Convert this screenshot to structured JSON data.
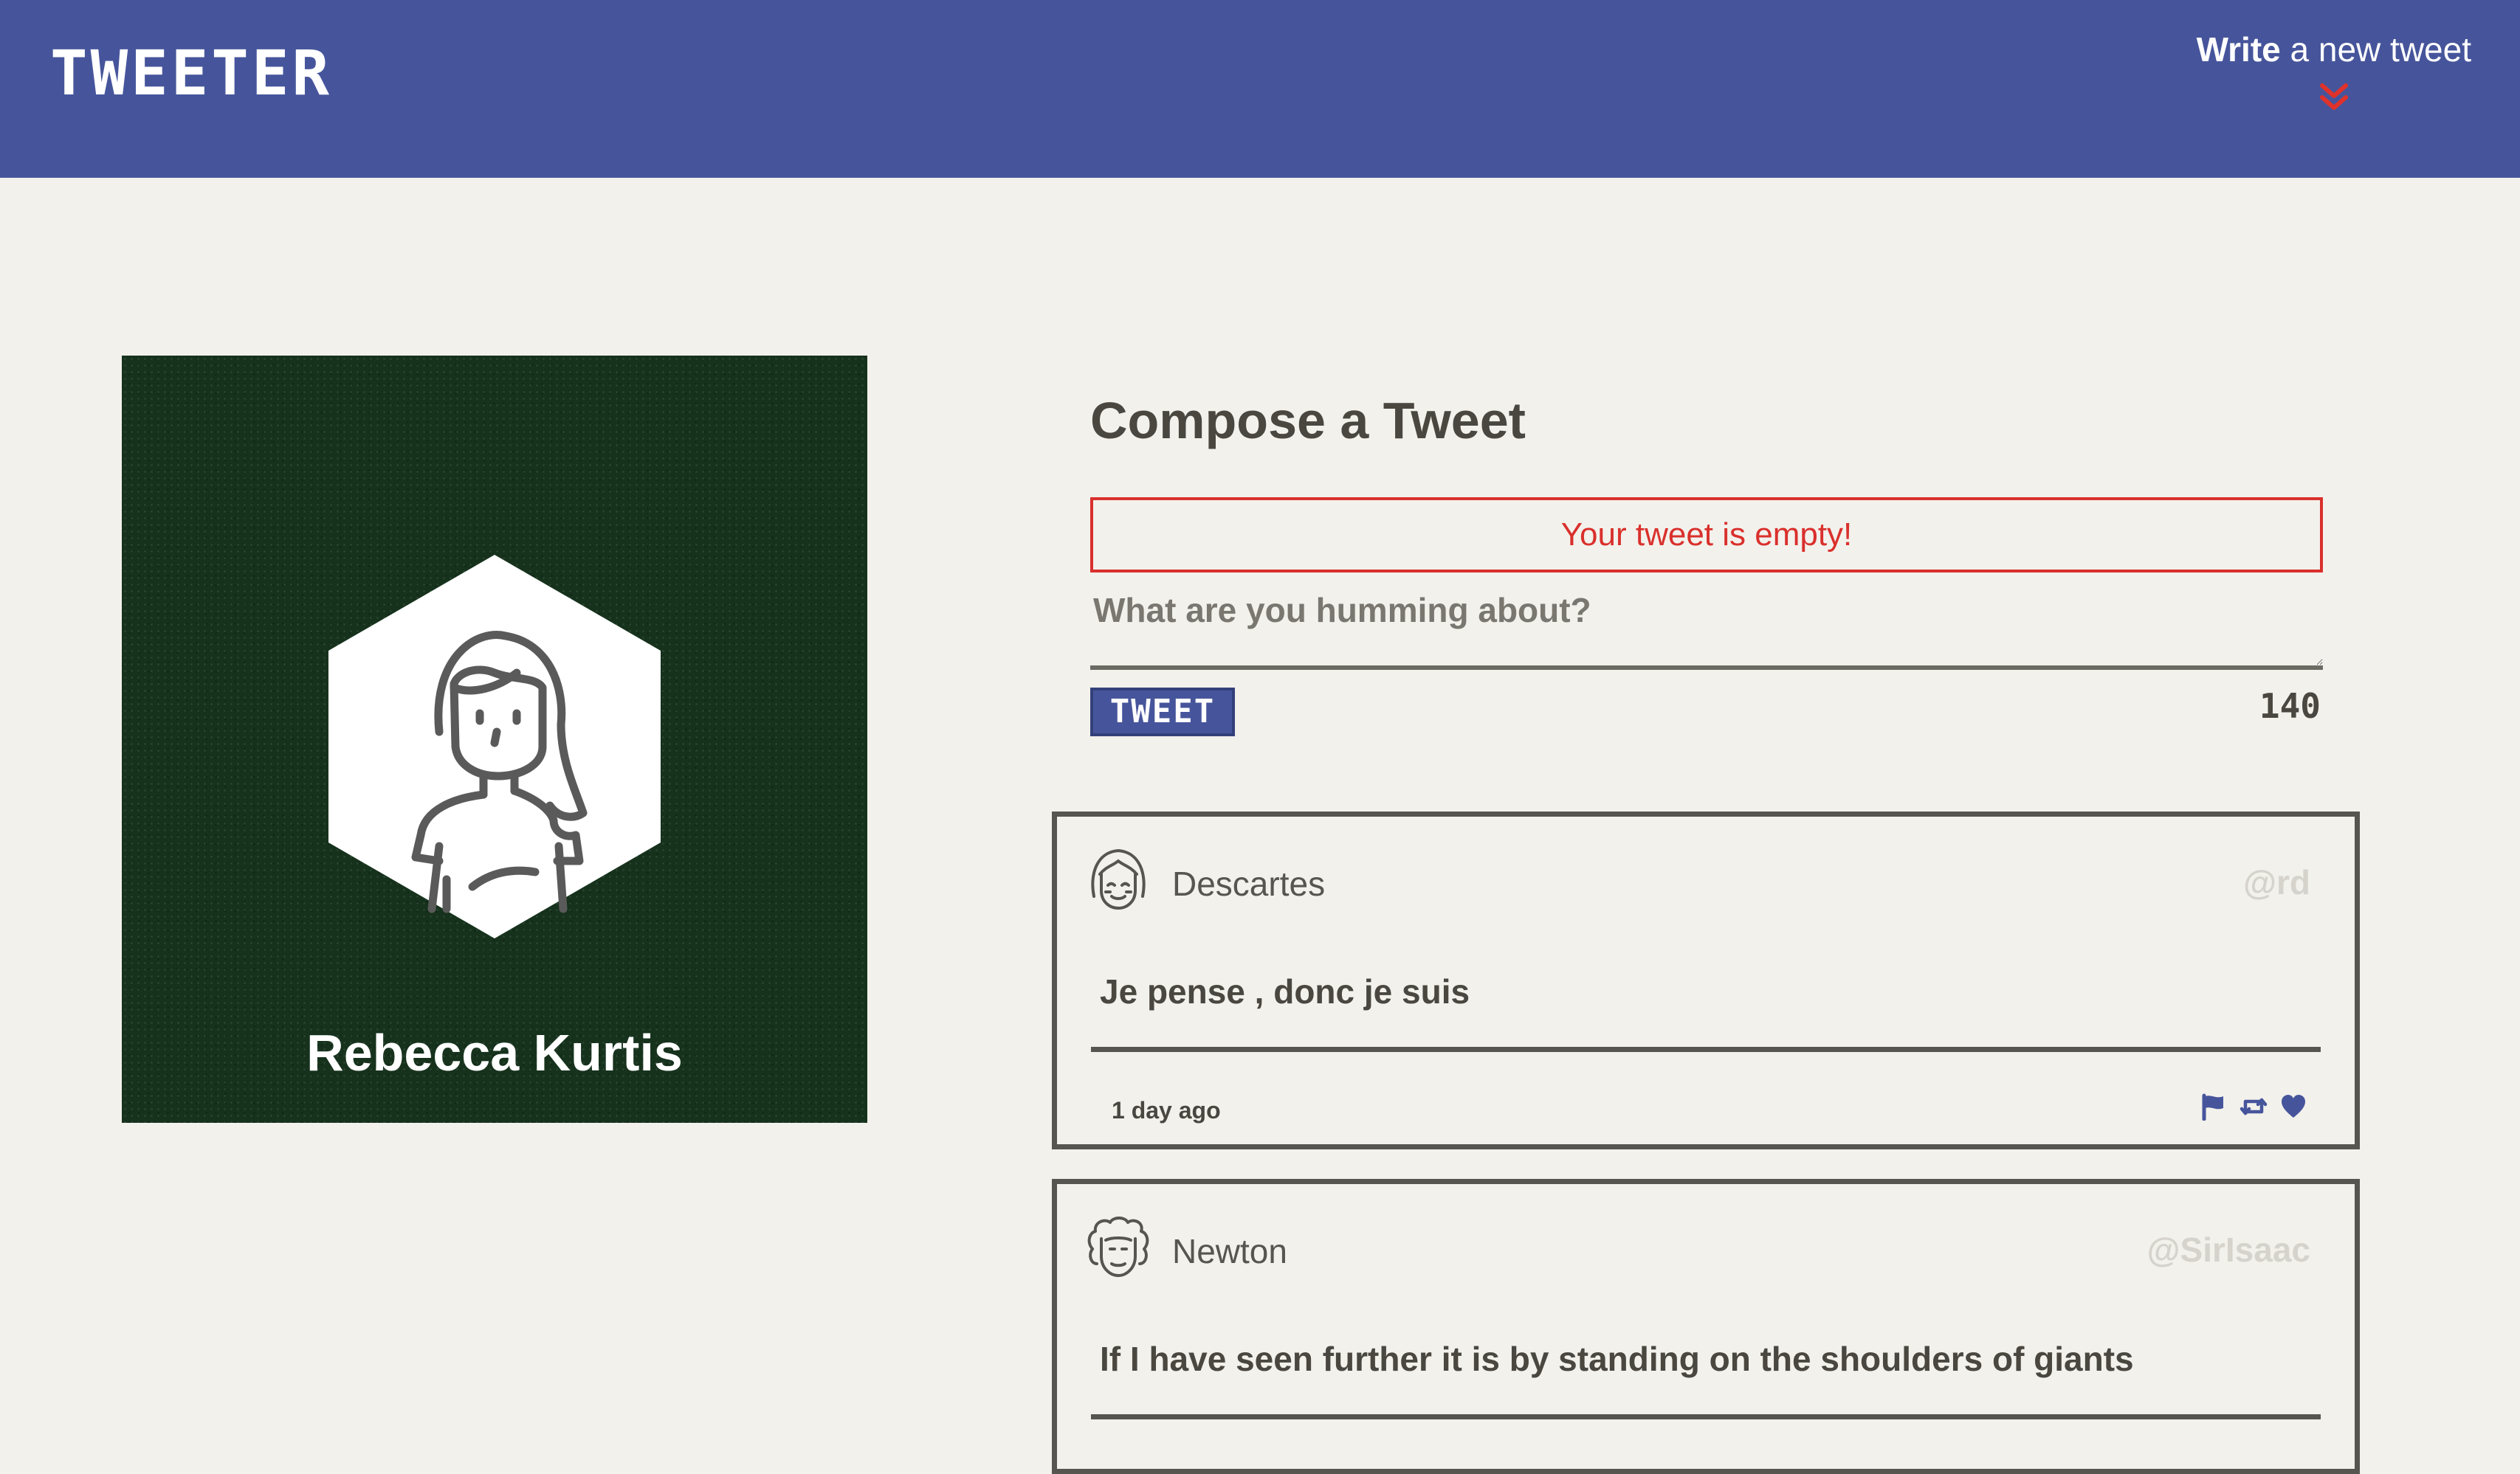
{
  "nav": {
    "brand": "TWEETER",
    "write_bold": "Write",
    "write_rest": " a new tweet",
    "chevron_icon": "double-chevron-down",
    "chevron_color": "#e0322b"
  },
  "profile": {
    "name": "Rebecca Kurtis",
    "avatar_icon": "woman-avatar-hexagon"
  },
  "compose": {
    "title": "Compose a Tweet",
    "error": "Your tweet is empty!",
    "placeholder": "What are you humming about?",
    "submit_label": "TWEET",
    "counter": "140"
  },
  "tweets": [
    {
      "name": "Descartes",
      "handle": "@rd",
      "text": "Je pense , donc je suis",
      "time": "1 day ago",
      "avatar_icon": "descartes-avatar"
    },
    {
      "name": "Newton",
      "handle": "@SirIsaac",
      "text": "If I have seen further it is by standing on the shoulders of giants",
      "avatar_icon": "newton-avatar"
    }
  ],
  "colors": {
    "nav_bg": "#46559b",
    "page_bg": "#f3f1ec",
    "error": "#d9302c",
    "profile_bg": "#16321d",
    "action_icons": "#46559b"
  }
}
